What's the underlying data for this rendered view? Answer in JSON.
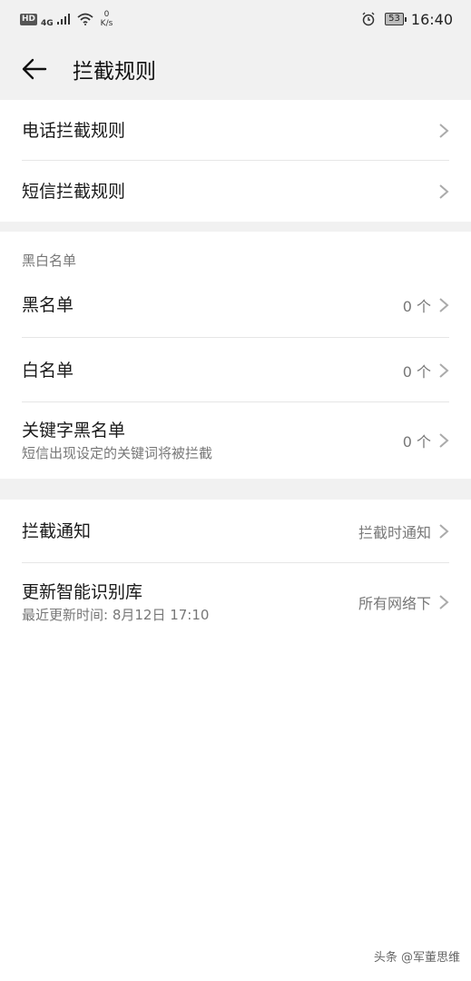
{
  "status_bar": {
    "hd": "HD",
    "network": "4G",
    "speed_value": "0",
    "speed_unit": "K/s",
    "battery": "53",
    "time": "16:40"
  },
  "app_bar": {
    "title": "拦截规则"
  },
  "rules_section": {
    "items": [
      {
        "label": "电话拦截规则"
      },
      {
        "label": "短信拦截规则"
      }
    ]
  },
  "list_section": {
    "header": "黑白名单",
    "items": [
      {
        "label": "黑名单",
        "value": "0 个"
      },
      {
        "label": "白名单",
        "value": "0 个"
      },
      {
        "label": "关键字黑名单",
        "sublabel": "短信出现设定的关键词将被拦截",
        "value": "0 个"
      }
    ]
  },
  "settings_section": {
    "items": [
      {
        "label": "拦截通知",
        "value": "拦截时通知"
      },
      {
        "label": "更新智能识别库",
        "sublabel": "最近更新时间: 8月12日 17:10",
        "value": "所有网络下"
      }
    ]
  },
  "watermark": "头条 @军董思维"
}
